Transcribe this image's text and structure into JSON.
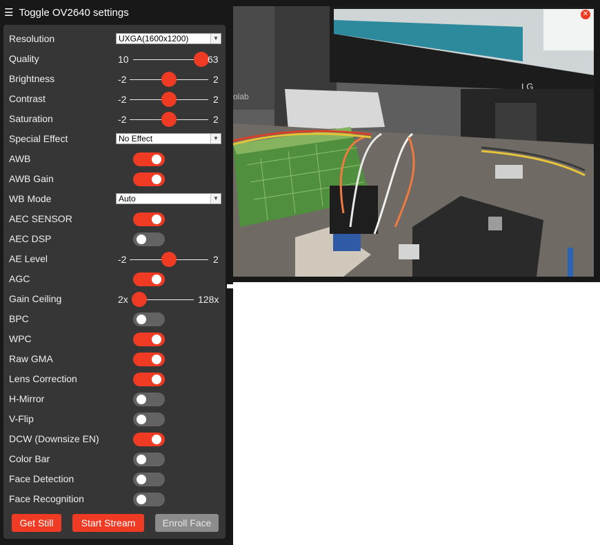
{
  "header": {
    "title": "Toggle OV2640 settings",
    "menu_icon": "hamburger-icon"
  },
  "settings": {
    "resolution": {
      "label": "Resolution",
      "value": "UXGA(1600x1200)"
    },
    "quality": {
      "label": "Quality",
      "min": "10",
      "max": "63",
      "value": 63
    },
    "brightness": {
      "label": "Brightness",
      "min": "-2",
      "max": "2",
      "value": 0
    },
    "contrast": {
      "label": "Contrast",
      "min": "-2",
      "max": "2",
      "value": 0
    },
    "saturation": {
      "label": "Saturation",
      "min": "-2",
      "max": "2",
      "value": 0
    },
    "special_effect": {
      "label": "Special Effect",
      "value": "No Effect"
    },
    "awb": {
      "label": "AWB",
      "on": true
    },
    "awb_gain": {
      "label": "AWB Gain",
      "on": true
    },
    "wb_mode": {
      "label": "WB Mode",
      "value": "Auto"
    },
    "aec_sensor": {
      "label": "AEC SENSOR",
      "on": true
    },
    "aec_dsp": {
      "label": "AEC DSP",
      "on": false
    },
    "ae_level": {
      "label": "AE Level",
      "min": "-2",
      "max": "2",
      "value": 0
    },
    "agc": {
      "label": "AGC",
      "on": true
    },
    "gain_ceiling": {
      "label": "Gain Ceiling",
      "min": "2x",
      "max": "128x",
      "value": 0
    },
    "bpc": {
      "label": "BPC",
      "on": false
    },
    "wpc": {
      "label": "WPC",
      "on": true
    },
    "raw_gma": {
      "label": "Raw GMA",
      "on": true
    },
    "lens_correction": {
      "label": "Lens Correction",
      "on": true
    },
    "h_mirror": {
      "label": "H-Mirror",
      "on": false
    },
    "v_flip": {
      "label": "V-Flip",
      "on": false
    },
    "dcw": {
      "label": "DCW (Downsize EN)",
      "on": true
    },
    "color_bar": {
      "label": "Color Bar",
      "on": false
    },
    "face_detection": {
      "label": "Face Detection",
      "on": false
    },
    "face_recognition": {
      "label": "Face Recognition",
      "on": false
    }
  },
  "buttons": {
    "get_still": "Get Still",
    "start_stream": "Start Stream",
    "enroll_face": "Enroll Face"
  },
  "stream": {
    "monitor_brand": "LG",
    "board_text": "olab",
    "close_icon": "close-icon"
  },
  "colors": {
    "accent": "#ef3b24",
    "panel": "#363636",
    "background": "#181818",
    "toggle_off": "#636363",
    "disabled_button": "#8c8c8c"
  }
}
